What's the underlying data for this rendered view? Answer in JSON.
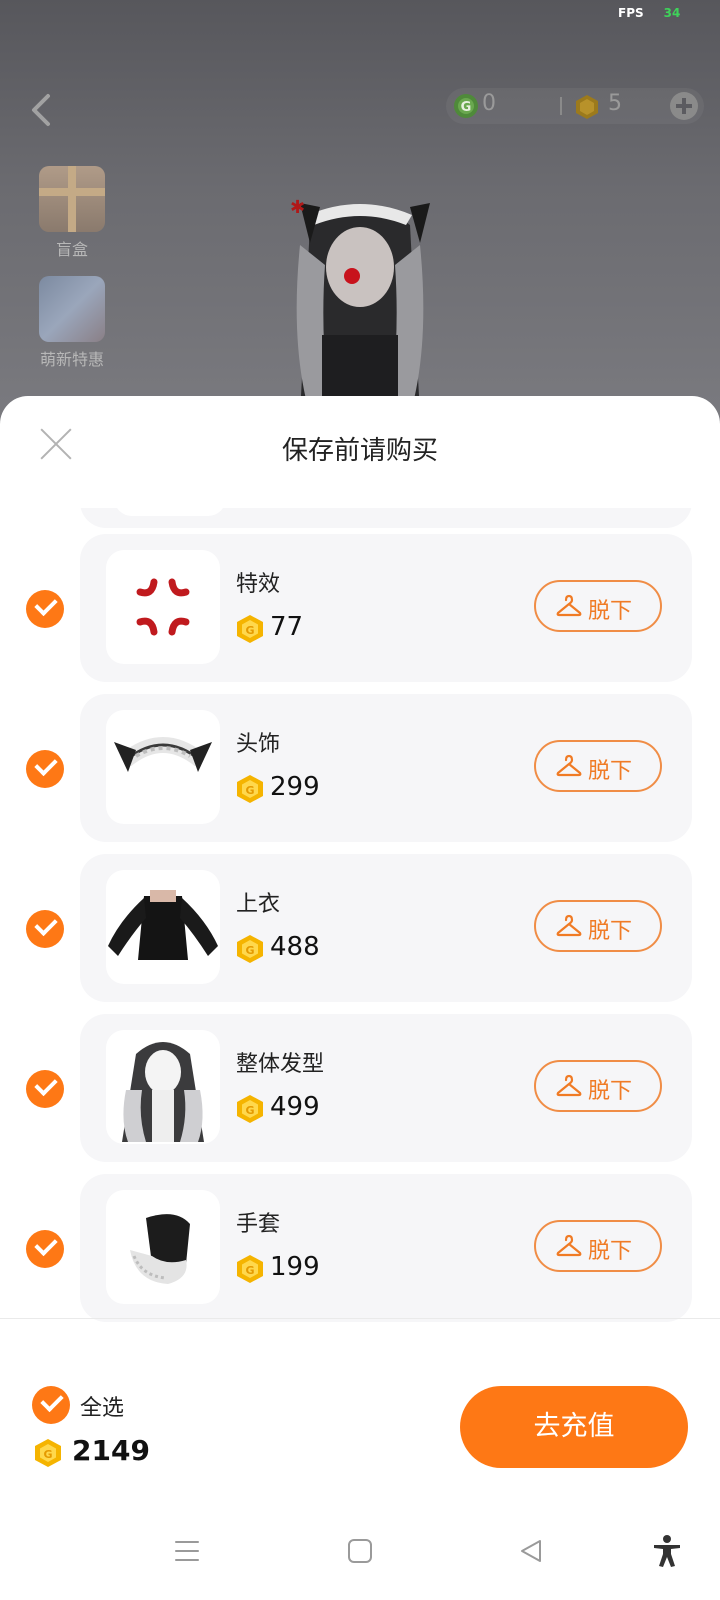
{
  "status": {
    "fps_label": "FPS",
    "fps_value": "34"
  },
  "header": {
    "currency_g": "0",
    "currency_coin": "5"
  },
  "side_menu": [
    {
      "label": "盲盒"
    },
    {
      "label": "萌新特惠"
    }
  ],
  "sheet": {
    "title": "保存前请购买",
    "items": [
      {
        "name": "特效",
        "price": "77",
        "button": "脱下"
      },
      {
        "name": "头饰",
        "price": "299",
        "button": "脱下"
      },
      {
        "name": "上衣",
        "price": "488",
        "button": "脱下"
      },
      {
        "name": "整体发型",
        "price": "499",
        "button": "脱下"
      },
      {
        "name": "手套",
        "price": "199",
        "button": "脱下"
      }
    ]
  },
  "footer": {
    "select_all": "全选",
    "total": "2149",
    "recharge": "去充值"
  },
  "colors": {
    "accent": "#fe7815",
    "coin": "#f5b400"
  },
  "icons": [
    "back-icon",
    "g-currency-icon",
    "coin-icon",
    "plus-icon",
    "close-icon",
    "check-icon",
    "hanger-icon",
    "menu-icon",
    "home-icon",
    "back-triangle-icon",
    "accessibility-icon"
  ]
}
